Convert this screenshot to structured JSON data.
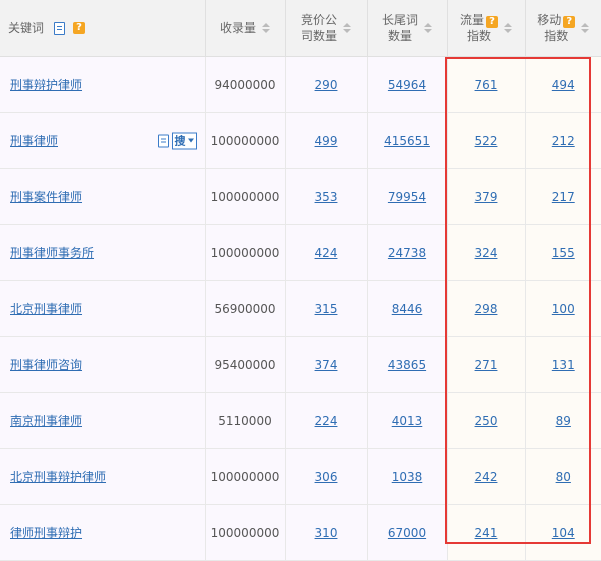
{
  "header": {
    "keyword": "关键词",
    "index_count": "收录量",
    "bid_companies": [
      "竞价公",
      "司数量"
    ],
    "long_tail": [
      "长尾词",
      "数量"
    ],
    "traffic_index": [
      "流量",
      "指数"
    ],
    "mobile_index": [
      "移动",
      "指数"
    ],
    "help": "?"
  },
  "search_button": {
    "label": "搜"
  },
  "rows": [
    {
      "keyword": "刑事辩护律师",
      "index_count": "94000000",
      "bid_companies": "290",
      "long_tail": "54964",
      "traffic_index": "761",
      "mobile_index": "494"
    },
    {
      "keyword": "刑事律师",
      "index_count": "100000000",
      "bid_companies": "499",
      "long_tail": "415651",
      "traffic_index": "522",
      "mobile_index": "212"
    },
    {
      "keyword": "刑事案件律师",
      "index_count": "100000000",
      "bid_companies": "353",
      "long_tail": "79954",
      "traffic_index": "379",
      "mobile_index": "217"
    },
    {
      "keyword": "刑事律师事务所",
      "index_count": "100000000",
      "bid_companies": "424",
      "long_tail": "24738",
      "traffic_index": "324",
      "mobile_index": "155"
    },
    {
      "keyword": "北京刑事律师",
      "index_count": "56900000",
      "bid_companies": "315",
      "long_tail": "8446",
      "traffic_index": "298",
      "mobile_index": "100"
    },
    {
      "keyword": "刑事律师咨询",
      "index_count": "95400000",
      "bid_companies": "374",
      "long_tail": "43865",
      "traffic_index": "271",
      "mobile_index": "131"
    },
    {
      "keyword": "南京刑事律师",
      "index_count": "5110000",
      "bid_companies": "224",
      "long_tail": "4013",
      "traffic_index": "250",
      "mobile_index": "89"
    },
    {
      "keyword": "北京刑事辩护律师",
      "index_count": "100000000",
      "bid_companies": "306",
      "long_tail": "1038",
      "traffic_index": "242",
      "mobile_index": "80"
    },
    {
      "keyword": "律师刑事辩护",
      "index_count": "100000000",
      "bid_companies": "310",
      "long_tail": "67000",
      "traffic_index": "241",
      "mobile_index": "104"
    }
  ],
  "colors": {
    "link": "#2f6db3",
    "highlight_border": "#e53935",
    "help_badge": "#f5a623"
  }
}
